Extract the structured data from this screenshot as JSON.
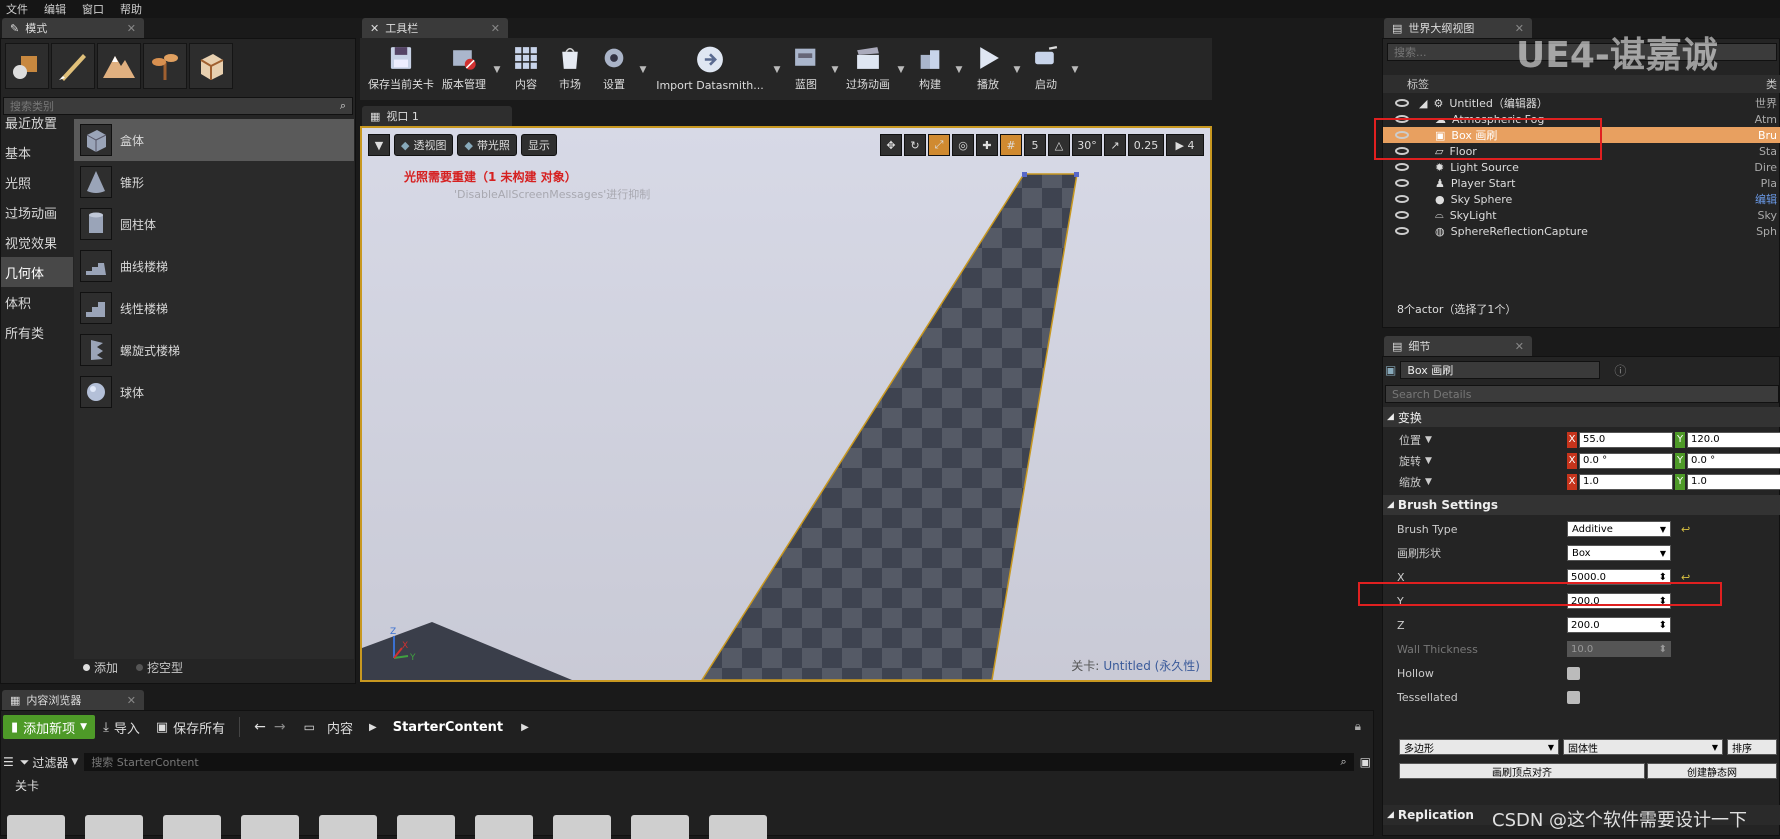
{
  "menu": [
    "文件",
    "编辑",
    "窗口",
    "帮助"
  ],
  "modes_panel": {
    "tab": "模式",
    "search_placeholder": "搜索类别",
    "categories": [
      "最近放置",
      "基本",
      "光照",
      "过场动画",
      "视觉效果",
      "几何体",
      "体积",
      "所有类"
    ],
    "active_category": "几何体",
    "shapes": [
      "盒体",
      "锥形",
      "圆柱体",
      "曲线楼梯",
      "线性楼梯",
      "螺旋式楼梯",
      "球体"
    ],
    "selected_shape": "盒体",
    "add_label": "添加",
    "subtract_label": "挖空型"
  },
  "toolbar": {
    "tab": "工具栏",
    "buttons": [
      "保存当前关卡",
      "版本管理",
      "内容",
      "市场",
      "设置",
      "Import Datasmith...",
      "蓝图",
      "过场动画",
      "构建",
      "播放",
      "启动"
    ]
  },
  "viewport": {
    "tab": "视口 1",
    "perspective": "透视图",
    "lit": "带光照",
    "show": "显示",
    "grid_size": "5",
    "rotation_snap": "30°",
    "scale_snap": "0.25",
    "camera_speed": "4",
    "warning": "光照需要重建（1 未构建 对象）",
    "hint": "'DisableAllScreenMessages'进行抑制",
    "level_label": "关卡:",
    "level_name": "Untitled (永久性)"
  },
  "outliner": {
    "tab": "世界大纲视图",
    "search_placeholder": "搜索...",
    "col_label": "标签",
    "col_type": "类",
    "root": "Untitled（编辑器）",
    "root_type": "世界",
    "items": [
      {
        "label": "Atmospheric Fog",
        "type": "Atm"
      },
      {
        "label": "Box 画刷",
        "type": "Bru"
      },
      {
        "label": "Floor",
        "type": "Sta"
      },
      {
        "label": "Light Source",
        "type": "Dire"
      },
      {
        "label": "Player Start",
        "type": "Pla"
      },
      {
        "label": "Sky Sphere",
        "type": "编辑"
      },
      {
        "label": "SkyLight",
        "type": "Sky"
      },
      {
        "label": "SphereReflectionCapture",
        "type": "Sph"
      }
    ],
    "selected": "Box 画刷",
    "footer": "8个actor（选择了1个）"
  },
  "details": {
    "tab": "细节",
    "name": "Box 画刷",
    "search_placeholder": "Search Details",
    "transform_section": "变换",
    "location_label": "位置",
    "rotation_label": "旋转",
    "scale_label": "缩放",
    "location": {
      "x": "55.0",
      "y": "120.0"
    },
    "rotation": {
      "x": "0.0 °",
      "y": "0.0 °"
    },
    "scale": {
      "x": "1.0",
      "y": "1.0"
    },
    "brush_section": "Brush Settings",
    "brush_type_label": "Brush Type",
    "brush_type": "Additive",
    "brush_shape_label": "画刷形状",
    "brush_shape": "Box",
    "x_label": "X",
    "x_value": "5000.0",
    "y_label": "Y",
    "y_value": "200.0",
    "z_label": "Z",
    "z_value": "200.0",
    "wall_label": "Wall Thickness",
    "wall_value": "10.0",
    "hollow_label": "Hollow",
    "tess_label": "Tessellated",
    "poly_dd": "多边形",
    "solid_dd": "固体性",
    "order_dd": "排序",
    "align_btn": "画刷顶点对齐",
    "create_btn": "创建静态网",
    "replication": "Replication"
  },
  "content_browser": {
    "tab": "内容浏览器",
    "add_new": "添加新项",
    "import": "导入",
    "save_all": "保存所有",
    "path_root": "内容",
    "path_current": "StarterContent",
    "filter": "过滤器",
    "search_placeholder": "搜索 StarterContent",
    "level_folder": "关卡"
  },
  "watermark_top": "UE4-谌嘉诚",
  "watermark_bottom": "CSDN @这个软件需要设计一下",
  "colors": {
    "selection": "#e8a060",
    "red_highlight": "#e02020",
    "add_green": "#4e9a28"
  }
}
